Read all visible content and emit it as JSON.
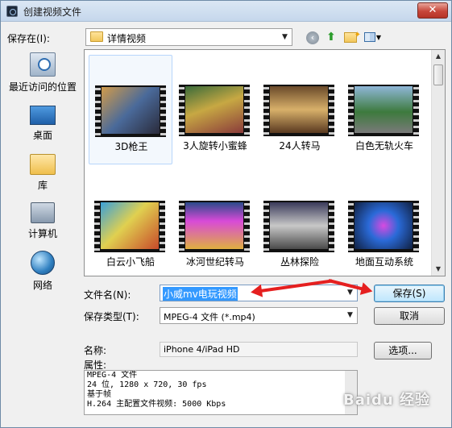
{
  "window": {
    "title": "创建视频文件",
    "close": "✕"
  },
  "location": {
    "label": "保存在(I):",
    "value": "详情视频",
    "arrow": "▼"
  },
  "toolbar": {
    "back": "‹",
    "up": "⬆"
  },
  "places": [
    {
      "label": "最近访问的位置",
      "icon": "recent-places-icon"
    },
    {
      "label": "桌面",
      "icon": "desktop-icon"
    },
    {
      "label": "库",
      "icon": "library-icon"
    },
    {
      "label": "计算机",
      "icon": "computer-icon"
    },
    {
      "label": "网络",
      "icon": "network-icon"
    }
  ],
  "files": [
    {
      "name": "3D枪王"
    },
    {
      "name": "3人旋转小蜜蜂"
    },
    {
      "name": "24人转马"
    },
    {
      "name": "白色无轨火车"
    },
    {
      "name": "白云小飞船"
    },
    {
      "name": "冰河世纪转马"
    },
    {
      "name": "丛林探险"
    },
    {
      "name": "地面互动系统"
    }
  ],
  "scroll": {
    "up": "▲",
    "down": "▼"
  },
  "form": {
    "filename_label": "文件名(N):",
    "filename_value": "小威mv电玩视频",
    "filetype_label": "保存类型(T):",
    "filetype_value": "MPEG-4 文件 (*.mp4)",
    "name_label": "名称:",
    "name_value": "iPhone 4/iPad HD",
    "props_label": "属性:",
    "props_lines": [
      "MPEG-4 文件",
      "24 位, 1280 x 720, 30 fps",
      "基于帧",
      "H.264 主配置文件视频: 5000 Kbps"
    ]
  },
  "buttons": {
    "save": "保存(S)",
    "cancel": "取消",
    "options": "选项..."
  },
  "watermark": "Baidu 经验",
  "colors": {
    "annotation_arrow": "#e51f1f",
    "selection": "#3399ff"
  }
}
